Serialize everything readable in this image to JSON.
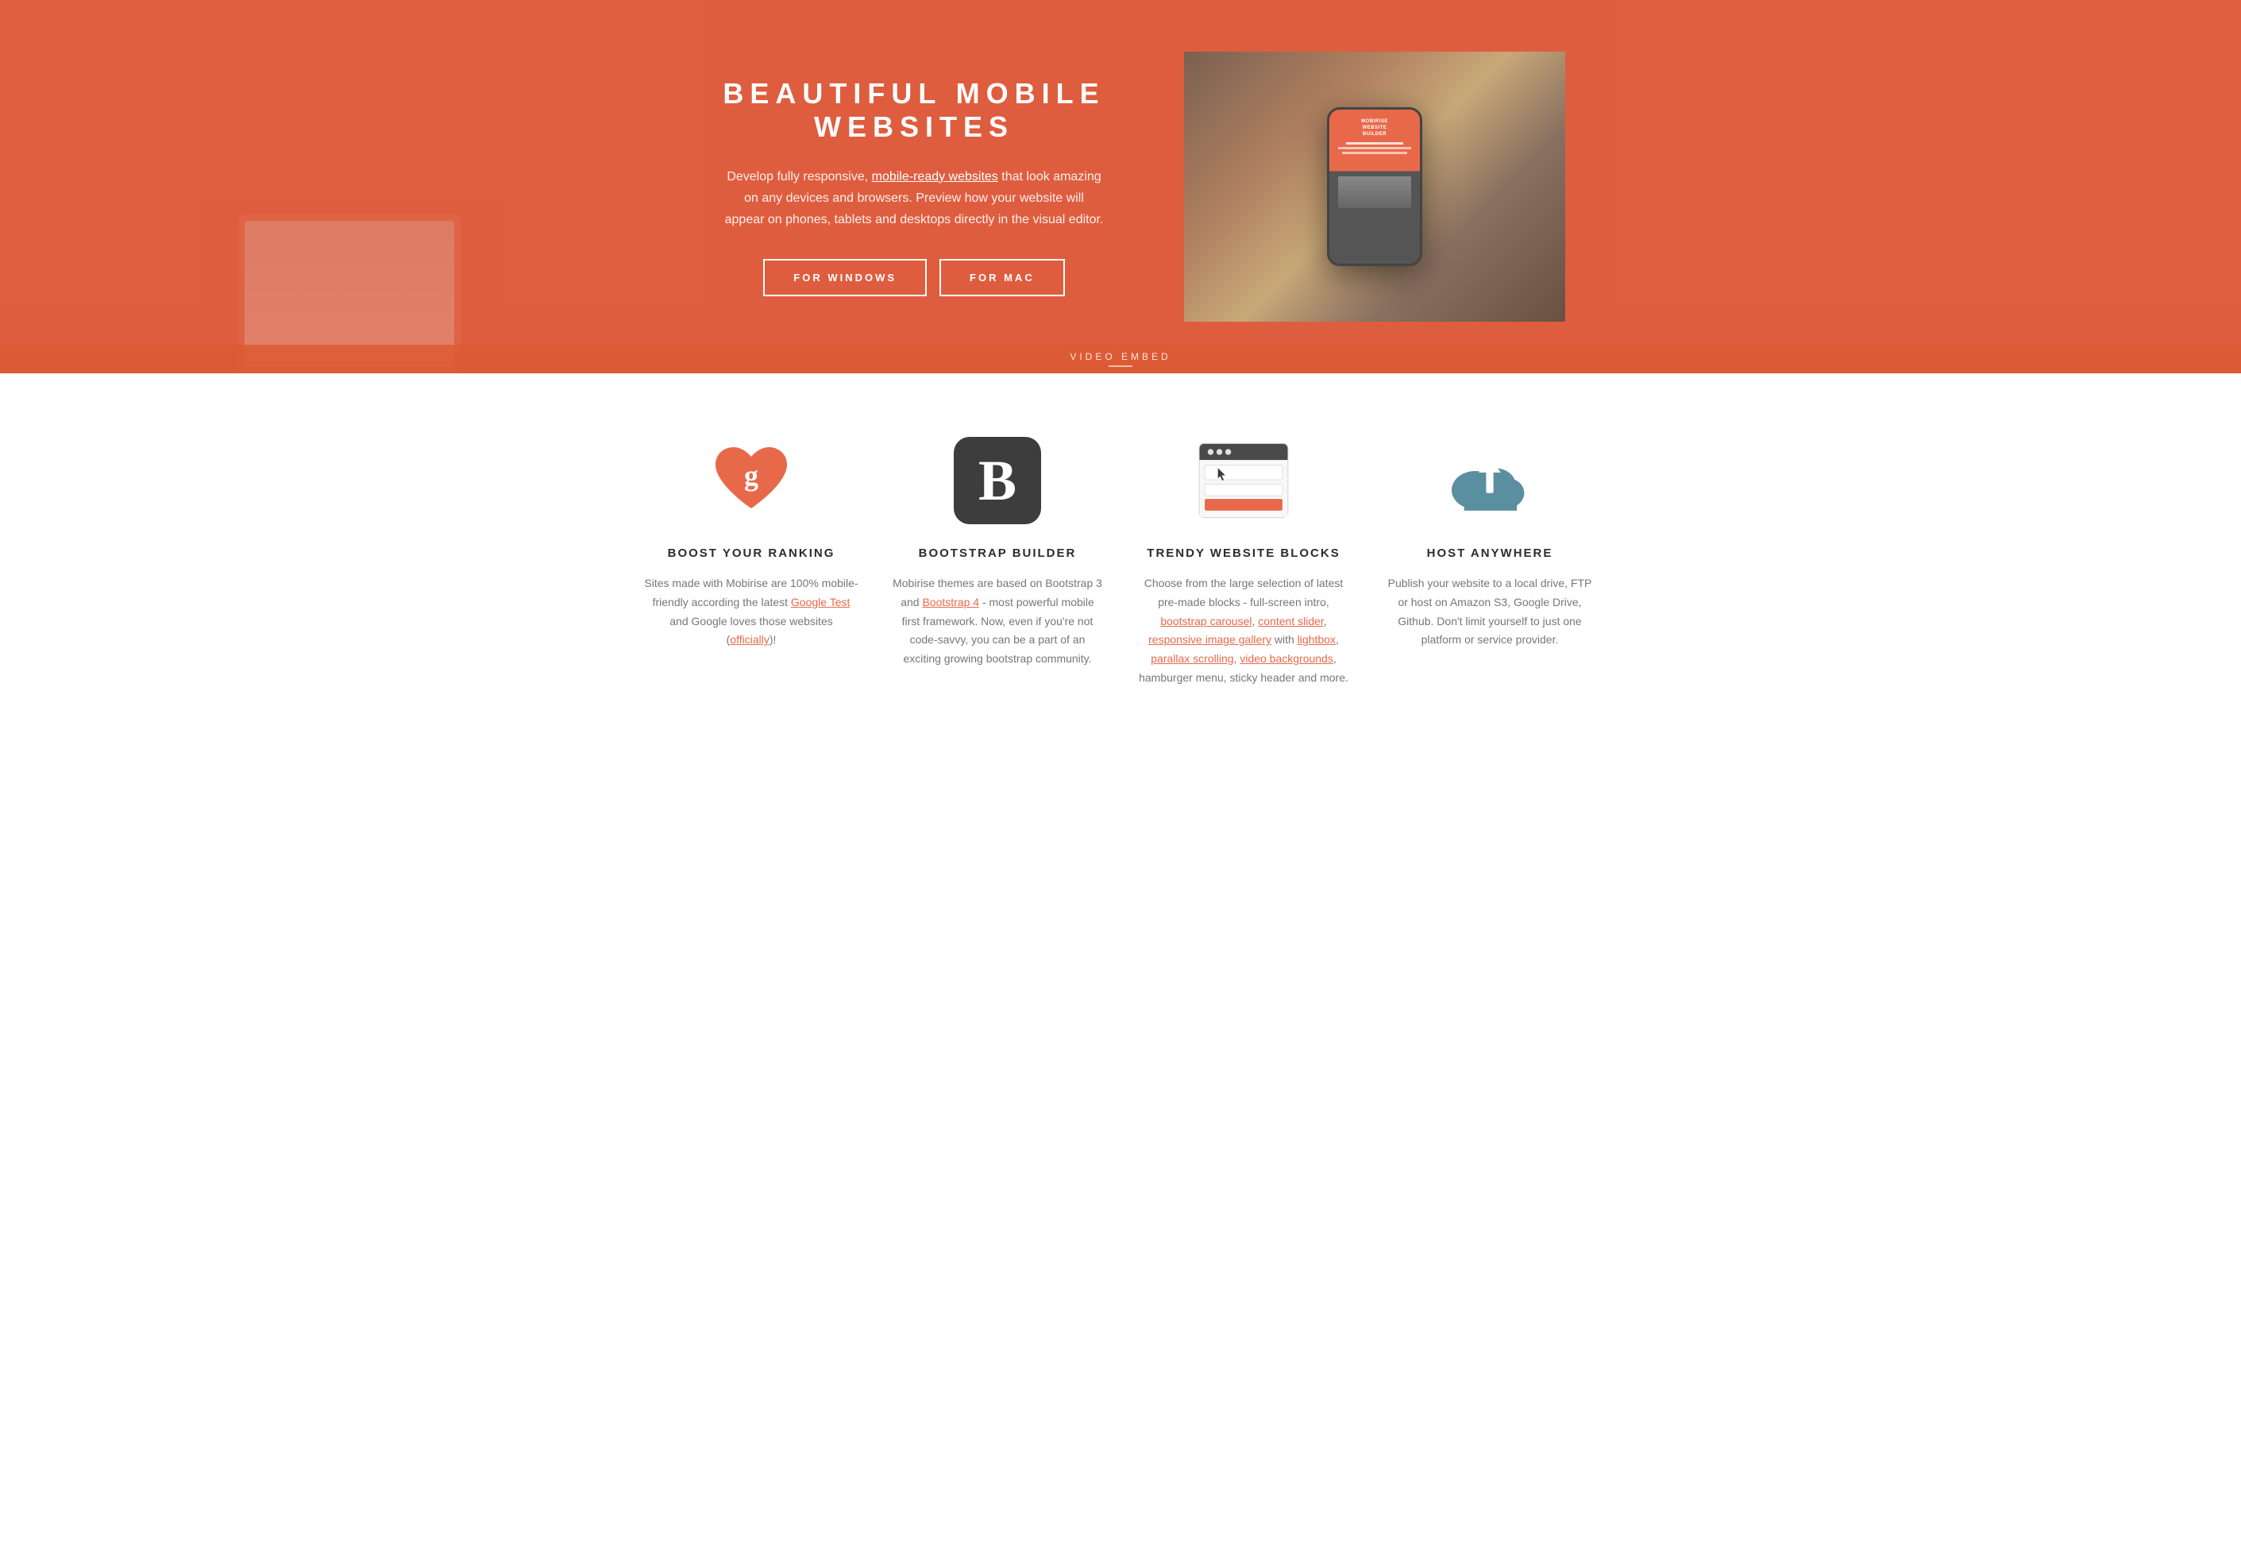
{
  "hero": {
    "title": "BEAUTIFUL MOBILE WEBSITES",
    "description_part1": "Develop fully responsive, ",
    "description_link": "mobile-ready websites",
    "description_part2": " that look amazing on any devices and browsers. Preview how your website will appear on phones, tablets and desktops directly in the visual editor.",
    "btn_windows": "FOR WINDOWS",
    "btn_mac": "FOR MAC",
    "video_embed_label": "VIDEO EMBED",
    "phone_screen_title": "MOBIRISE\nWEBSITE\nBUILDER"
  },
  "features": {
    "items": [
      {
        "id": "boost",
        "title": "BOOST YOUR RANKING",
        "desc_plain": "Sites made with Mobirise are 100% mobile-friendly according the latest ",
        "desc_link1": "Google Test",
        "desc_mid": " and Google loves those websites (",
        "desc_link2": "officially",
        "desc_end": ")!"
      },
      {
        "id": "bootstrap",
        "title": "BOOTSTRAP BUILDER",
        "desc_plain": "Mobirise themes are based on Bootstrap 3 and ",
        "desc_link1": "Bootstrap 4",
        "desc_mid": " - most powerful mobile first framework. Now, even if you're not code-savvy, you can be a part of an exciting growing bootstrap community.",
        "desc_link2": "",
        "desc_end": ""
      },
      {
        "id": "trendy",
        "title": "TRENDY WEBSITE BLOCKS",
        "desc_plain": "Choose from the large selection of latest pre-made blocks - full-screen intro, ",
        "desc_link1": "bootstrap carousel",
        "desc_sep1": ", ",
        "desc_link2": "content slider",
        "desc_sep2": ", ",
        "desc_link3": "responsive image gallery",
        "desc_mid": " with ",
        "desc_link4": "lightbox",
        "desc_sep3": ", ",
        "desc_link5": "parallax scrolling",
        "desc_sep4": ", ",
        "desc_link6": "video backgrounds",
        "desc_end": ", hamburger menu, sticky header and more."
      },
      {
        "id": "host",
        "title": "HOST ANYWHERE",
        "desc_plain": "Publish your website to a local drive, FTP or host on Amazon S3, Google Drive, Github. Don't limit yourself to just one platform or service provider.",
        "desc_link1": "",
        "desc_mid": "",
        "desc_end": ""
      }
    ]
  }
}
